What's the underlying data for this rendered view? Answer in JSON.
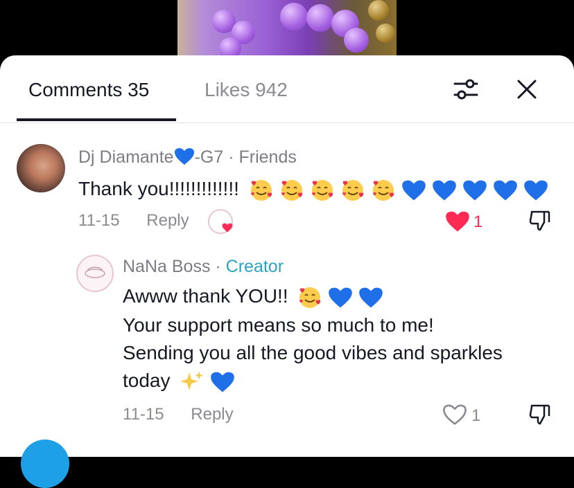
{
  "tabs": {
    "comments_label": "Comments 35",
    "likes_label": "Likes 942"
  },
  "comments": [
    {
      "author": "Dj Diamante",
      "author_suffix": "-G7",
      "relation": "Friends",
      "text": "Thank you!!!!!!!!!!!!!",
      "emojis": [
        "smiling-face-hearts",
        "smiling-face-hearts",
        "smiling-face-hearts",
        "smiling-face-hearts",
        "smiling-face-hearts",
        "blue-heart",
        "blue-heart",
        "blue-heart",
        "blue-heart",
        "blue-heart"
      ],
      "date": "11-15",
      "reply_label": "Reply",
      "like_count": "1",
      "liked": true
    }
  ],
  "reply": {
    "author": "NaNa Boss",
    "role": "Creator",
    "line1": "Awww thank YOU!!",
    "line2": "Your support means so much to me!",
    "line3": "Sending you all the good vibes and sparkles",
    "line4": "today",
    "date": "11-15",
    "reply_label": "Reply",
    "like_count": "1",
    "liked": false
  },
  "colors": {
    "text": "#161823",
    "muted": "#8a8b91",
    "creator": "#2aa3bf",
    "like_red": "#fe2c55",
    "blue_heart": "#1e6fe8"
  }
}
